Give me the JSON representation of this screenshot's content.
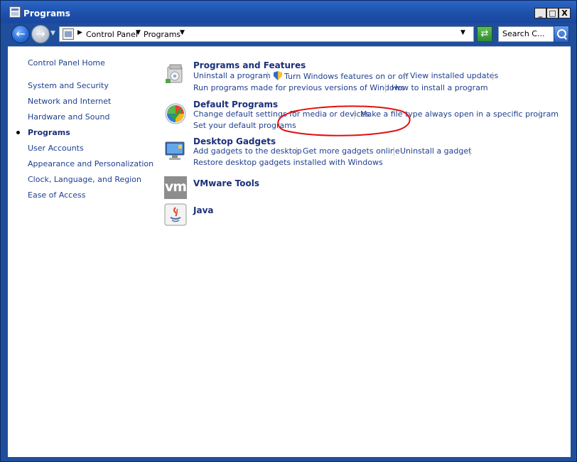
{
  "window": {
    "title": "Programs"
  },
  "title_buttons": {
    "minimize": "_",
    "maximize": "□",
    "close": "X"
  },
  "address": {
    "breadcrumbs": [
      "Control Panel",
      "Programs"
    ],
    "search_placeholder": "Search C..."
  },
  "sidebar": {
    "items": [
      {
        "label": "Control Panel Home",
        "active": false
      },
      {
        "label": "System and Security",
        "active": false
      },
      {
        "label": "Network and Internet",
        "active": false
      },
      {
        "label": "Hardware and Sound",
        "active": false
      },
      {
        "label": "Programs",
        "active": true
      },
      {
        "label": "User Accounts",
        "active": false
      },
      {
        "label": "Appearance and Personalization",
        "active": false
      },
      {
        "label": "Clock, Language, and Region",
        "active": false
      },
      {
        "label": "Ease of Access",
        "active": false
      }
    ]
  },
  "categories": {
    "programs_features": {
      "title": "Programs and Features",
      "icon": "programs-features-icon",
      "links": [
        "Uninstall a program",
        "Turn Windows features on or off",
        "View installed updates",
        "Run programs made for previous versions of Windows",
        "How to install a program"
      ]
    },
    "default_programs": {
      "title": "Default Programs",
      "icon": "default-programs-icon",
      "links": [
        "Change default settings for media or devices",
        "Make a file type always open in a specific program",
        "Set your default programs"
      ]
    },
    "desktop_gadgets": {
      "title": "Desktop Gadgets",
      "icon": "desktop-gadgets-icon",
      "links": [
        "Add gadgets to the desktop",
        "Get more gadgets online",
        "Uninstall a gadget",
        "Restore desktop gadgets installed with Windows"
      ]
    },
    "vmware_tools": {
      "title": "VMware Tools",
      "icon": "vmware-icon",
      "icon_text": "vm"
    },
    "java": {
      "title": "Java",
      "icon": "java-icon"
    }
  },
  "colors": {
    "link": "#1e3f8f",
    "heading": "#1a2f7a",
    "titlebar": "#1c4fa8",
    "annotation": "#e01010"
  }
}
